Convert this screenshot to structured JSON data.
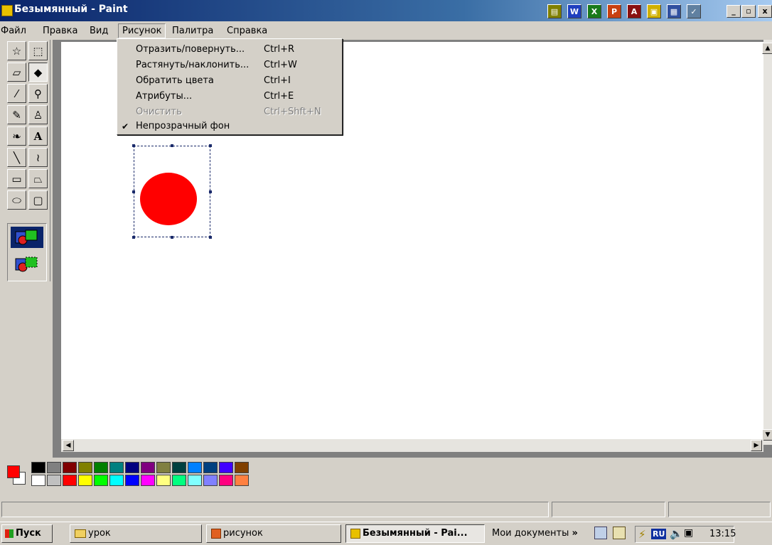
{
  "window": {
    "title": "Безымянный - Paint"
  },
  "window_buttons": [
    "_",
    "▫",
    "x"
  ],
  "menubar": {
    "items": [
      "Файл",
      "Правка",
      "Вид",
      "Рисунок",
      "Палитра",
      "Справка"
    ],
    "active": "Рисунок"
  },
  "dropdown": {
    "items": [
      {
        "label": "Отразить/повернуть...",
        "shortcut": "Ctrl+R",
        "enabled": true,
        "checked": false
      },
      {
        "label": "Растянуть/наклонить...",
        "shortcut": "Ctrl+W",
        "enabled": true,
        "checked": false
      },
      {
        "label": "Обратить цвета",
        "shortcut": "Ctrl+I",
        "enabled": true,
        "checked": false
      },
      {
        "label": "Атрибуты...",
        "shortcut": "Ctrl+E",
        "enabled": true,
        "checked": false
      },
      {
        "label": "Очистить",
        "shortcut": "Ctrl+Shft+N",
        "enabled": false,
        "checked": false
      },
      {
        "label": "Непрозрачный фон",
        "shortcut": "",
        "enabled": true,
        "checked": true
      }
    ],
    "check_mark": "✔"
  },
  "toolbox": {
    "tools": [
      {
        "name": "free-select",
        "glyph": "☆"
      },
      {
        "name": "rect-select",
        "glyph": "⬚"
      },
      {
        "name": "eraser",
        "glyph": "▱"
      },
      {
        "name": "fill",
        "glyph": "◆"
      },
      {
        "name": "pick-color",
        "glyph": "⁄"
      },
      {
        "name": "magnifier",
        "glyph": "⚲"
      },
      {
        "name": "pencil",
        "glyph": "✎"
      },
      {
        "name": "brush",
        "glyph": "♙"
      },
      {
        "name": "airbrush",
        "glyph": "❧"
      },
      {
        "name": "text",
        "glyph": "A"
      },
      {
        "name": "line",
        "glyph": "╲"
      },
      {
        "name": "curve",
        "glyph": "≀"
      },
      {
        "name": "rectangle",
        "glyph": "▭"
      },
      {
        "name": "polygon",
        "glyph": "⏢"
      },
      {
        "name": "ellipse",
        "glyph": "⬭"
      },
      {
        "name": "rounded-rectangle",
        "glyph": "▢"
      }
    ]
  },
  "palette": {
    "foreground": "#ff0000",
    "background": "#ffffff",
    "row1": [
      "#000000",
      "#808080",
      "#800000",
      "#808000",
      "#008000",
      "#008080",
      "#000080",
      "#800080",
      "#808040",
      "#004040",
      "#0080ff",
      "#004080",
      "#4000ff",
      "#804000"
    ],
    "row2": [
      "#ffffff",
      "#c0c0c0",
      "#ff0000",
      "#ffff00",
      "#00ff00",
      "#00ffff",
      "#0000ff",
      "#ff00ff",
      "#ffff80",
      "#00ff80",
      "#80ffff",
      "#8080ff",
      "#ff0080",
      "#ff8040"
    ]
  },
  "canvas": {
    "shape_color": "#ff0000"
  },
  "taskbar": {
    "start": "Пуск",
    "buttons": [
      {
        "label": "урок",
        "pressed": false
      },
      {
        "label": "рисунок",
        "pressed": false
      },
      {
        "label": "Безымянный - Pai...",
        "pressed": true
      }
    ],
    "quick_folder": "Мои документы",
    "quick_more": "»",
    "lang": "RU",
    "clock": "13:15"
  },
  "icons": {
    "title": "paint-app-icon",
    "tray": [
      "network-icon",
      "volume-icon",
      "monitor-icon"
    ]
  }
}
